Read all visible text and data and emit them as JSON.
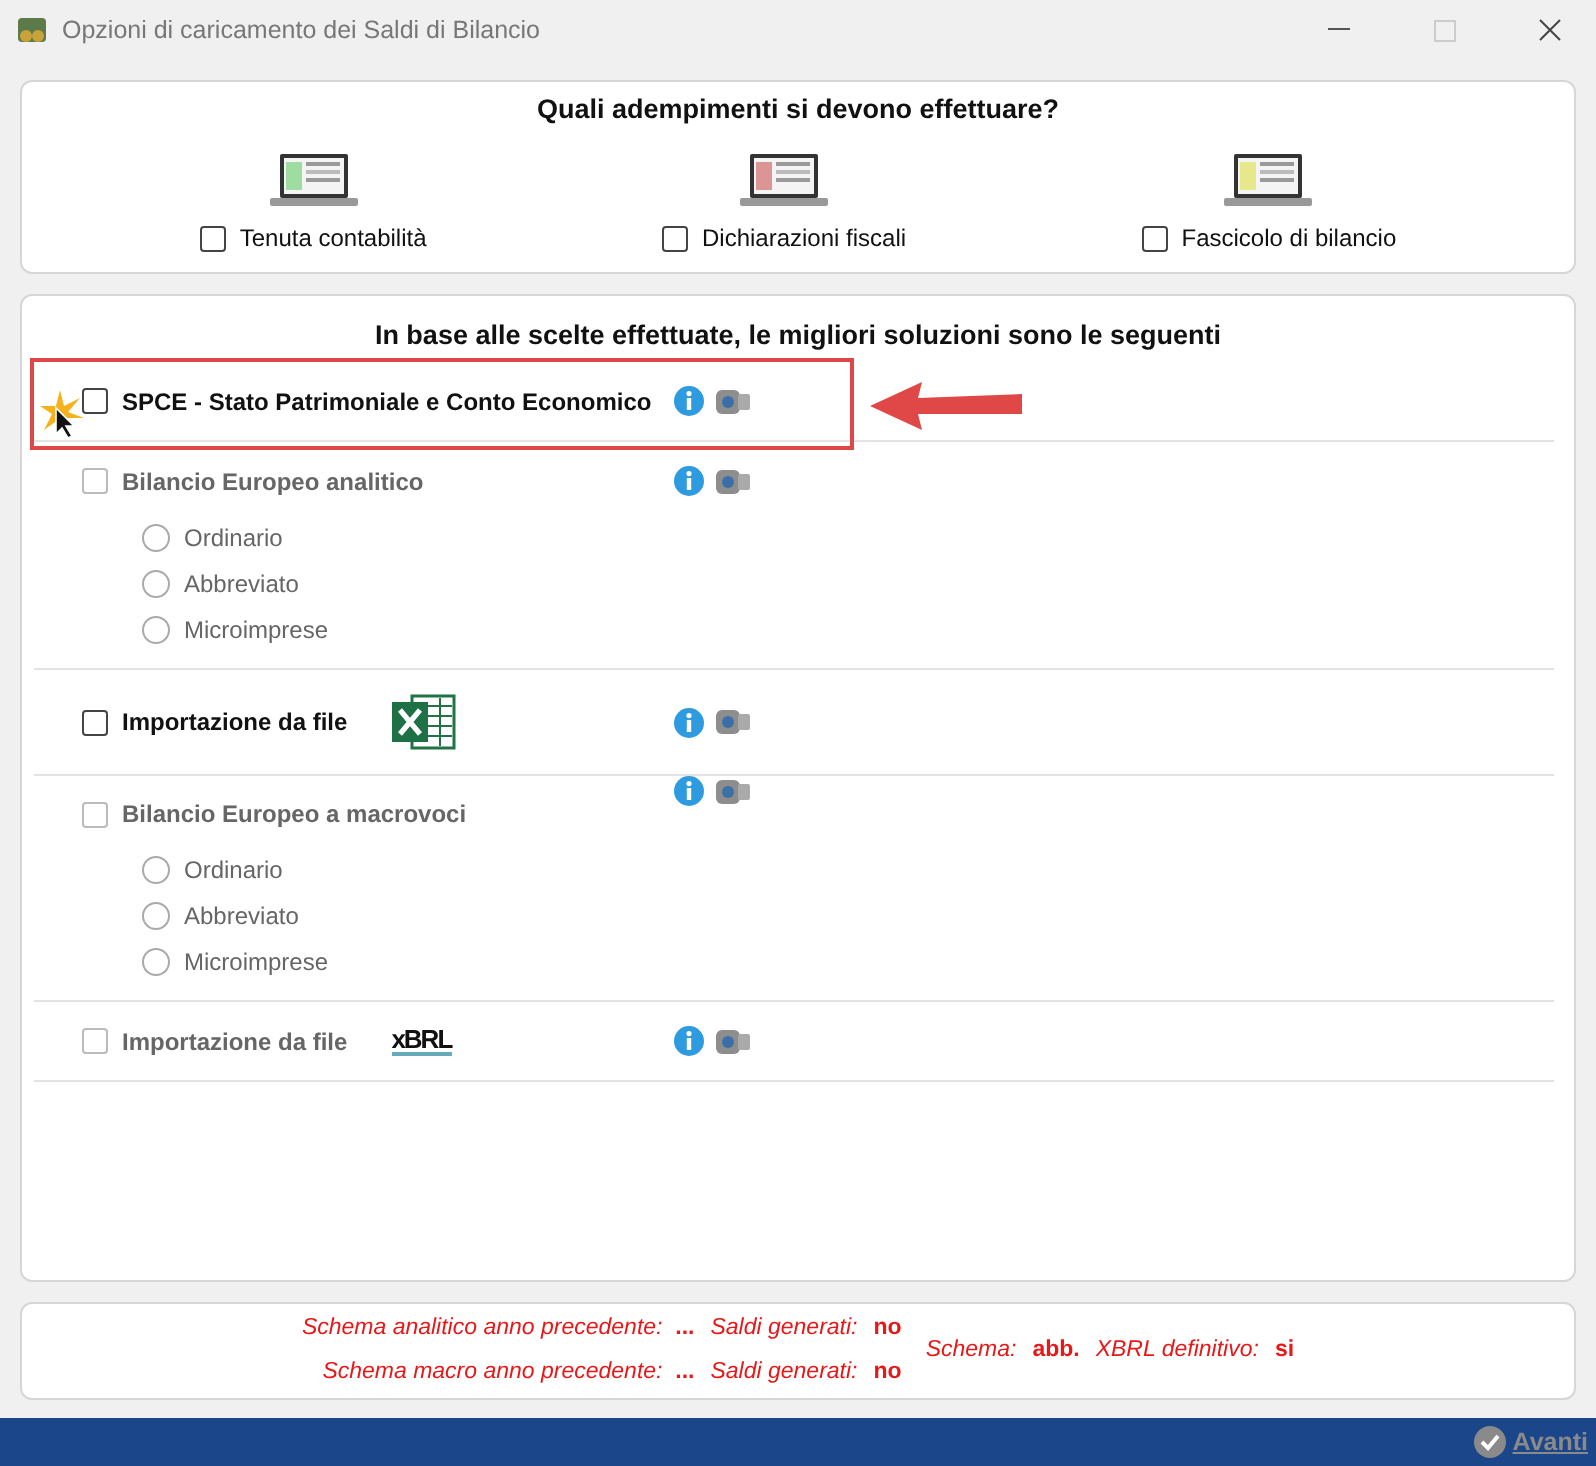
{
  "window": {
    "title": "Opzioni di caricamento dei Saldi di Bilancio"
  },
  "tasks": {
    "title": "Quali adempimenti si devono effettuare?",
    "items": [
      {
        "label": "Tenuta contabilità",
        "checked": false
      },
      {
        "label": "Dichiarazioni fiscali",
        "checked": false
      },
      {
        "label": "Fascicolo di bilancio",
        "checked": false
      }
    ]
  },
  "solutions": {
    "title": "In base alle scelte effettuate, le migliori soluzioni sono le seguenti",
    "options": [
      {
        "kind": "checkbox",
        "label": "SPCE  -  Stato Patrimoniale e Conto Economico",
        "checked": false,
        "disabled": false,
        "highlighted": true
      },
      {
        "kind": "group",
        "label": "Bilancio Europeo analitico",
        "checked": false,
        "disabled": true,
        "highlighted": false,
        "sub_options": [
          {
            "label": "Ordinario",
            "selected": false
          },
          {
            "label": "Abbreviato",
            "selected": false
          },
          {
            "label": "Microimprese",
            "selected": false
          }
        ]
      },
      {
        "kind": "excel",
        "label": "Importazione da file",
        "checked": false,
        "disabled": false,
        "highlighted": false
      },
      {
        "kind": "group",
        "label": "Bilancio Europeo a macrovoci",
        "checked": false,
        "disabled": true,
        "highlighted": false,
        "sub_options": [
          {
            "label": "Ordinario",
            "selected": false
          },
          {
            "label": "Abbreviato",
            "selected": false
          },
          {
            "label": "Microimprese",
            "selected": false
          }
        ]
      },
      {
        "kind": "xbrl",
        "label": "Importazione da file",
        "logo_text": "xBRL",
        "checked": false,
        "disabled": true,
        "highlighted": false
      }
    ]
  },
  "status": {
    "lines": [
      {
        "text": "*Schema analitico anno precedente:*  **...**",
        "label_2": "Saldi generati:",
        "value_2": "no"
      },
      {
        "text": "*Schema macro anno precedente:*  **...**",
        "label_2": "Saldi generati:",
        "value_2": "no"
      }
    ],
    "extra": [
      {
        "label": "Schema:",
        "value": "abb."
      },
      {
        "label": "XBRL definitivo:",
        "value": "si"
      }
    ]
  },
  "footer": {
    "next_button": {
      "label": "Avanti",
      "disabled": true
    }
  }
}
